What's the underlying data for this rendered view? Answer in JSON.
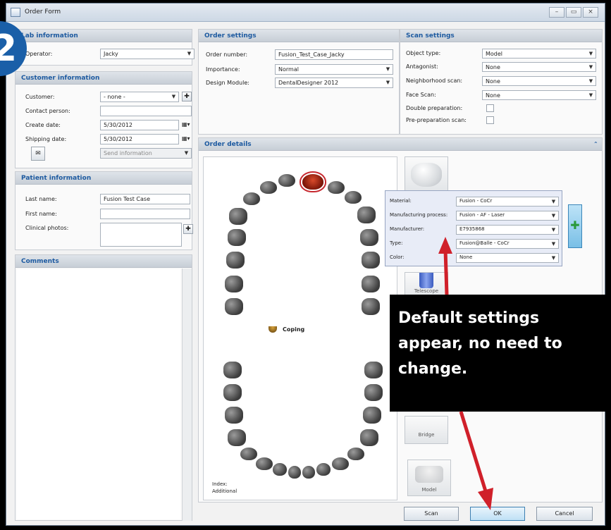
{
  "window": {
    "title": "Order Form"
  },
  "lab": {
    "header": "Lab information",
    "operator_label": "Operator:",
    "operator_value": "Jacky"
  },
  "customer": {
    "header": "Customer information",
    "customer_label": "Customer:",
    "customer_value": "- none -",
    "contact_label": "Contact person:",
    "create_date_label": "Create date:",
    "create_date_value": "5/30/2012",
    "shipping_date_label": "Shipping date:",
    "shipping_date_value": "5/30/2012",
    "send_info_placeholder": "Send information"
  },
  "patient": {
    "header": "Patient information",
    "last_name_label": "Last name:",
    "last_name_value": "Fusion Test Case",
    "first_name_label": "First name:",
    "clinical_photos_label": "Clinical photos:"
  },
  "comments": {
    "header": "Comments"
  },
  "order_settings": {
    "header": "Order settings",
    "order_number_label": "Order number:",
    "order_number_value": "Fusion_Test_Case_Jacky",
    "importance_label": "Importance:",
    "importance_value": "Normal",
    "design_module_label": "Design Module:",
    "design_module_value": "DentalDesigner 2012"
  },
  "scan_settings": {
    "header": "Scan settings",
    "object_type_label": "Object type:",
    "object_type_value": "Model",
    "antagonist_label": "Antagonist:",
    "antagonist_value": "None",
    "neighborhood_label": "Neighborhood scan:",
    "neighborhood_value": "None",
    "face_scan_label": "Face Scan:",
    "face_scan_value": "None",
    "double_prep_label": "Double preparation:",
    "pre_prep_label": "Pre-preparation scan:"
  },
  "order_details": {
    "header": "Order details",
    "coping_label": "Coping",
    "index_label": "Index:",
    "additional_label": "Additional",
    "tool_telescope": "Telescope",
    "tool_bridge": "Bridge",
    "tool_model": "Model"
  },
  "material_popup": {
    "material_label": "Material:",
    "material_value": "Fusion - CoCr",
    "process_label": "Manufacturing process:",
    "process_value": "Fusion - AF - Laser",
    "manufacturer_label": "Manufacturer:",
    "manufacturer_value": "E7935868",
    "type_label": "Type:",
    "type_value": "Fusion@Balle - CoCr",
    "color_label": "Color:",
    "color_value": "None"
  },
  "buttons": {
    "scan": "Scan",
    "ok": "OK",
    "cancel": "Cancel"
  },
  "callout": {
    "text": "Default settings appear, no need to change."
  },
  "step_badge": "2",
  "colors": {
    "callout_bg": "#000000",
    "arrow": "#d0202a",
    "badge": "#1a5fa8",
    "header_text": "#1d5aa0"
  }
}
